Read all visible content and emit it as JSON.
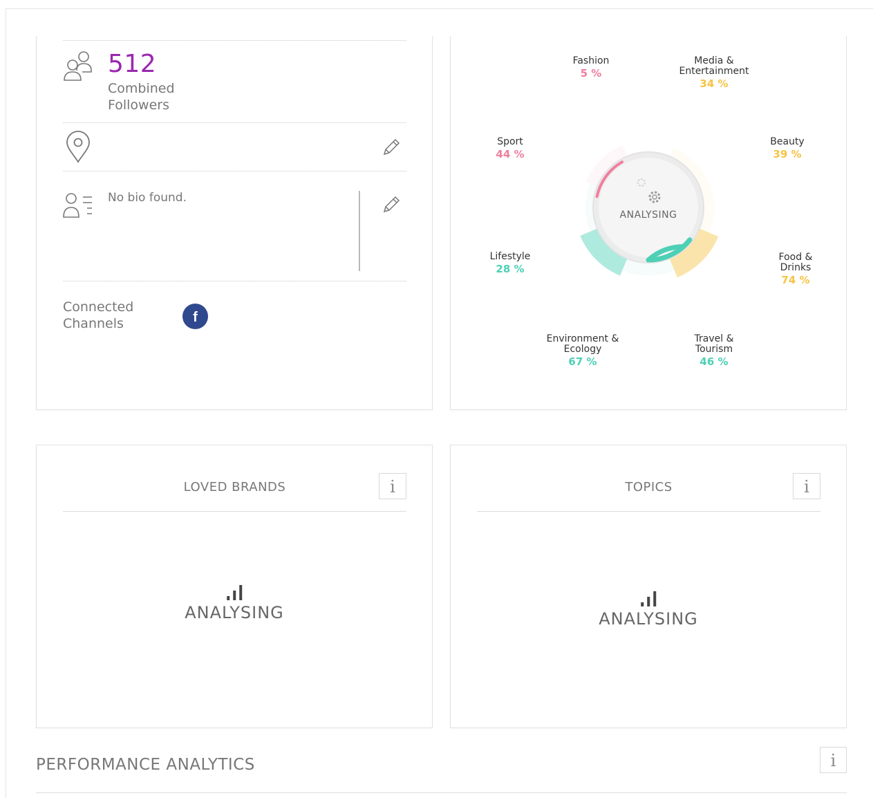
{
  "profile": {
    "followers_count": "512",
    "followers_label": "Combined Followers",
    "bio": "No bio found.",
    "channels_label": "Connected Channels",
    "channels": [
      {
        "network": "facebook",
        "icon": "facebook-icon",
        "glyph": "f",
        "color": "#30488e"
      }
    ]
  },
  "interests": {
    "status": "ANALYSING",
    "categories": [
      {
        "name": "Fashion",
        "percent": "5 %",
        "value": 5,
        "color": "#f07e9d"
      },
      {
        "name": "Media & Entertainment",
        "percent": "34 %",
        "value": 34,
        "color": "#f6c444"
      },
      {
        "name": "Beauty",
        "percent": "39 %",
        "value": 39,
        "color": "#f6c444"
      },
      {
        "name": "Food & Drinks",
        "percent": "74 %",
        "value": 74,
        "color": "#f6c444"
      },
      {
        "name": "Travel & Tourism",
        "percent": "46 %",
        "value": 46,
        "color": "#4dd0b6"
      },
      {
        "name": "Environment & Ecology",
        "percent": "67 %",
        "value": 67,
        "color": "#4dd0b6"
      },
      {
        "name": "Lifestyle",
        "percent": "28 %",
        "value": 28,
        "color": "#4dd0b6"
      },
      {
        "name": "Sport",
        "percent": "44 %",
        "value": 44,
        "color": "#f07e9d"
      }
    ]
  },
  "loved_brands": {
    "title": "LOVED BRANDS",
    "info": "i",
    "status": "ANALYSING"
  },
  "topics": {
    "title": "TOPICS",
    "info": "i",
    "status": "ANALYSING"
  },
  "performance": {
    "title": "PERFORMANCE ANALYTICS",
    "info": "i"
  },
  "colors": {
    "accent_purple": "#9b27af",
    "pink": "#f07e9d",
    "yellow": "#f6c444",
    "teal": "#4dd0b6",
    "facebook": "#30488e"
  }
}
